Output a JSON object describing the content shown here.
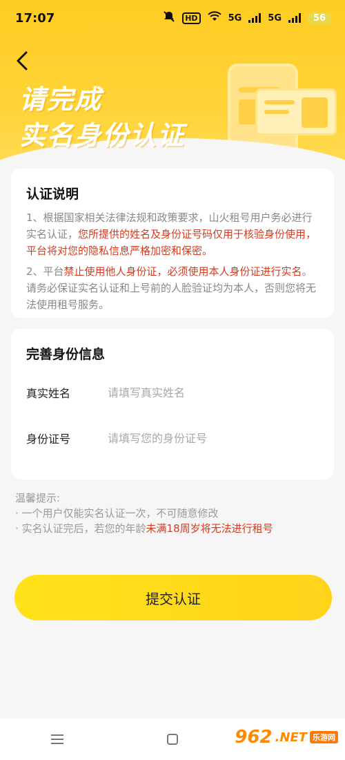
{
  "status_bar": {
    "time": "17:07",
    "hd_label": "HD",
    "net1": "5G",
    "net2": "5G",
    "battery": "56"
  },
  "header": {
    "back_icon": "chevron-left-icon",
    "title_line1": "请完成",
    "title_line2": "实名身份认证"
  },
  "notice_card": {
    "title": "认证说明",
    "p1_normal": "1、根据国家相关法律法规和政策要求，山火租号用户务必进行实名认证，",
    "p1_red": "您所提供的姓名及身份证号码仅用于核验身份使用，平台将对您的隐私信息严格加密和保密。",
    "p2_normal_a": "2、平台",
    "p2_red": "禁止使用他人身份证，必须使用本人身份证进行实名",
    "p2_normal_b": "。请务必保证实名认证和上号前的人脸验证均为本人，否则您将无法使用租号服务。"
  },
  "form_card": {
    "title": "完善身份信息",
    "name_label": "真实姓名",
    "name_placeholder": "请填写真实姓名",
    "name_value": "",
    "id_label": "身份证号",
    "id_placeholder": "请填写您的身份证号",
    "id_value": ""
  },
  "tips": {
    "heading": "温馨提示:",
    "line1": "· 一个用户仅能实名认证一次，不可随意修改",
    "line2_normal": "· 实名认证完后，若您的年龄",
    "line2_red": "未满18周岁将无法进行租号"
  },
  "submit_label": "提交认证",
  "nav": {
    "menu_icon": "menu-icon",
    "home_icon": "home-square-icon"
  },
  "watermark": {
    "brand": "962",
    "suffix": ".NET",
    "sub": "乐游网"
  },
  "colors": {
    "accent_yellow": "#ffd31a",
    "highlight_red": "#d33b20"
  }
}
